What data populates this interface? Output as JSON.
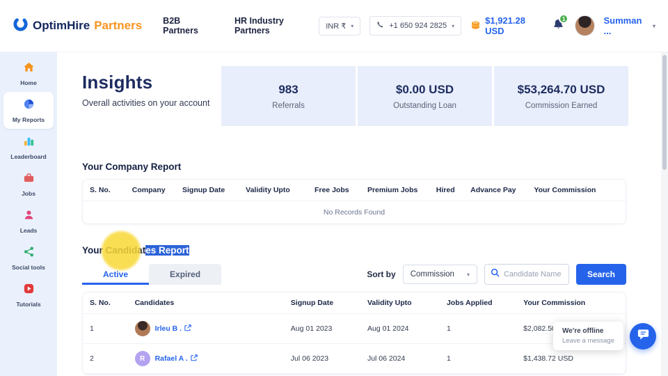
{
  "navbar": {
    "brand": {
      "primary": "OptimHire",
      "secondary": "Partners"
    },
    "links": [
      {
        "label": "B2B Partners"
      },
      {
        "label": "HR Industry Partners"
      }
    ],
    "currency_value": "INR ₹",
    "phone_value": "+1 650 924 2825",
    "balance": "$1,921.28 USD",
    "notification_count": "1",
    "user_name": "Summan ..."
  },
  "sidebar": {
    "items": [
      {
        "label": "Home",
        "icon": "home-icon"
      },
      {
        "label": "My Reports",
        "icon": "pie-chart-icon",
        "active": true
      },
      {
        "label": "Leaderboard",
        "icon": "bar-chart-icon"
      },
      {
        "label": "Jobs",
        "icon": "briefcase-icon"
      },
      {
        "label": "Leads",
        "icon": "person-icon"
      },
      {
        "label": "Social tools",
        "icon": "share-icon"
      },
      {
        "label": "Tutorials",
        "icon": "play-icon"
      }
    ]
  },
  "insights": {
    "title": "Insights",
    "subtitle": "Overall activities on your account",
    "stats": [
      {
        "value": "983",
        "label": "Referrals"
      },
      {
        "value": "$0.00 USD",
        "label": "Outstanding Loan"
      },
      {
        "value": "$53,264.70 USD",
        "label": "Commission Earned"
      }
    ]
  },
  "company_report": {
    "title": "Your Company Report",
    "headers": [
      "S. No.",
      "Company",
      "Signup Date",
      "Validity Upto",
      "Free Jobs",
      "Premium Jobs",
      "Hired",
      "Advance Pay",
      "Your Commission"
    ],
    "empty_text": "No Records Found"
  },
  "candidates_report": {
    "title_pre": "Your Candidat",
    "title_selected": "es Report",
    "tabs": [
      {
        "label": "Active",
        "active": true
      },
      {
        "label": "Expired"
      }
    ],
    "sort_label": "Sort by",
    "sort_value": "Commission",
    "search_placeholder": "Candidate Name",
    "search_button_label": "Search",
    "headers": [
      "S. No.",
      "Candidates",
      "Signup Date",
      "Validity Upto",
      "Jobs Applied",
      "Your Commission"
    ],
    "rows": [
      {
        "s_no": "1",
        "name": "Irleu B .",
        "signup_date": "Aug 01 2023",
        "validity_upto": "Aug 01 2024",
        "jobs_applied": "1",
        "commission": "$2,082.50 USD",
        "avatar_initial": ""
      },
      {
        "s_no": "2",
        "name": "Rafael A .",
        "signup_date": "Jul 06 2023",
        "validity_upto": "Jul 06 2024",
        "jobs_applied": "1",
        "commission": "$1,438.72 USD",
        "avatar_initial": "R"
      }
    ]
  },
  "chat": {
    "offline_text": "We're offline",
    "message_text": "Leave a message"
  },
  "colors": {
    "brand_blue": "#2563eb",
    "brand_orange": "#f7941d",
    "selection_blue": "#2d63d8",
    "click_highlight_yellow": "#f8d836",
    "badge_green": "#4caf50",
    "stat_card_bg": "#e8eefb"
  }
}
